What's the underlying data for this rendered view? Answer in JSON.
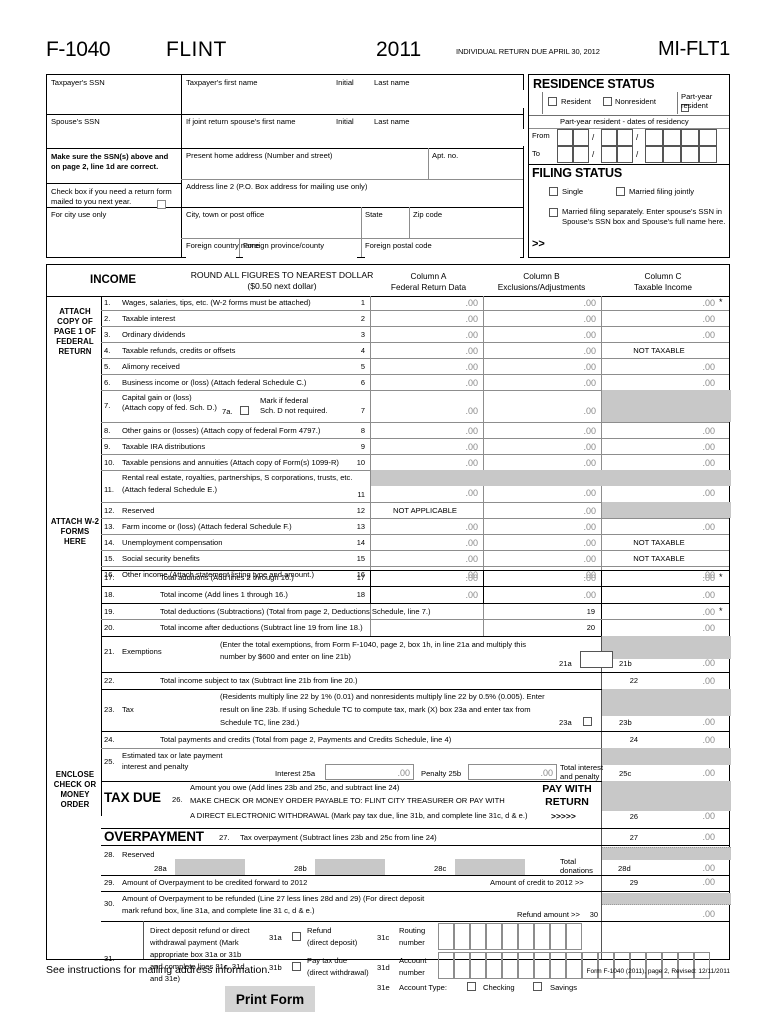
{
  "masthead": {
    "form_number": "F-1040",
    "city": "FLINT",
    "year": "2011",
    "due_notice": "INDIVIDUAL RETURN DUE APRIL 30, 2012",
    "form_code": "MI-FLT1"
  },
  "identity": {
    "taxpayer_ssn_label": "Taxpayer's SSN",
    "spouse_ssn_label": "Spouse's SSN",
    "ssn_warning": "Make sure the SSN(s) above and on page 2, line 1d are correct.",
    "mail_checkbox_note": "Check box if you need a return form mailed to you next year.",
    "city_use_label": "For city use only",
    "taxpayer_first_name_label": "Taxpayer's first name",
    "initial_label": "Initial",
    "last_name_label": "Last name",
    "spouse_first_name_label": "If joint return spouse's first name",
    "spouse_initial_label": "Initial",
    "spouse_last_name_label": "Last name",
    "home_address_label": "Present home address (Number and street)",
    "apt_label": "Apt. no.",
    "address2_label": "Address line 2 (P.O. Box address for mailing use only)",
    "city_label": "City, town or post office",
    "state_label": "State",
    "zip_label": "Zip code",
    "foreign_country_label": "Foreign country name",
    "foreign_province_label": "Foreign province/county",
    "foreign_postal_label": "Foreign postal code"
  },
  "residence": {
    "heading": "RESIDENCE STATUS",
    "options": [
      "Resident",
      "Nonresident",
      "Part-year resident"
    ],
    "dates_caption": "Part-year resident - dates of residency",
    "from_label": "From",
    "to_label": "To",
    "slash": "/"
  },
  "filing": {
    "heading": "FILING STATUS",
    "single": "Single",
    "joint": "Married filing jointly",
    "separate": "Married filing separately. Enter spouse's SSN in Spouse's SSN box and Spouse's full name here.",
    "arrow": ">>"
  },
  "income_header": {
    "title": "INCOME",
    "round_line1": "ROUND ALL FIGURES TO NEAREST DOLLAR",
    "round_line2": "($0.50 next dollar)",
    "col_a_1": "Column A",
    "col_a_2": "Federal Return Data",
    "col_b_1": "Column B",
    "col_b_2": "Exclusions/Adjustments",
    "col_c_1": "Column C",
    "col_c_2": "Taxable Income"
  },
  "side_notes": {
    "attach_federal": "ATTACH COPY OF PAGE 1 OF FEDERAL RETURN",
    "attach_w2": "ATTACH W-2 FORMS HERE",
    "enclose_check": "ENCLOSE CHECK OR MONEY ORDER"
  },
  "zero": ".00",
  "not_taxable": "NOT TAXABLE",
  "not_applicable": "NOT APPLICABLE",
  "star": "*",
  "rows": [
    {
      "no": "1.",
      "text": "Wages, salaries, tips, etc. (W-2 forms must be attached)",
      "ln": "1",
      "a": ".00",
      "b": ".00",
      "c": ".00",
      "star": true
    },
    {
      "no": "2.",
      "text": "Taxable interest",
      "ln": "2",
      "a": ".00",
      "b": ".00",
      "c": ".00"
    },
    {
      "no": "3.",
      "text": "Ordinary dividends",
      "ln": "3",
      "a": ".00",
      "b": ".00",
      "c": ".00"
    },
    {
      "no": "4.",
      "text": "Taxable refunds, credits or offsets",
      "ln": "4",
      "a": ".00",
      "b": ".00",
      "c": "NOT TAXABLE"
    },
    {
      "no": "5.",
      "text": "Alimony received",
      "ln": "5",
      "a": ".00",
      "b": ".00",
      "c": ".00"
    },
    {
      "no": "6.",
      "text": "Business income or (loss) (Attach federal Schedule C.)",
      "ln": "6",
      "a": ".00",
      "b": ".00",
      "c": ".00"
    },
    {
      "no": "7.",
      "text": "Capital gain or (loss) (Attach copy of fed. Sch. D.)",
      "sub": "7a.",
      "note": "Mark if federal Sch. D not required.",
      "ln": "7",
      "a": ".00",
      "b": ".00",
      "c": "SHADED"
    },
    {
      "no": "8.",
      "text": "Other gains or (losses)  (Attach copy of federal Form 4797.)",
      "ln": "8",
      "a": ".00",
      "b": ".00",
      "c": ".00"
    },
    {
      "no": "9.",
      "text": "Taxable IRA distributions",
      "ln": "9",
      "a": ".00",
      "b": ".00",
      "c": ".00"
    },
    {
      "no": "10.",
      "text": "Taxable pensions and annuities  (Attach copy of Form(s) 1099-R)",
      "ln": "10",
      "a": ".00",
      "b": ".00",
      "c": ".00"
    },
    {
      "no": "11.",
      "text": "Rental real estate, royalties, partnerships, S corporations, trusts, etc. (Attach federal Schedule E.)",
      "ln": "11",
      "a": ".00",
      "b": ".00",
      "c": ".00"
    },
    {
      "no": "12.",
      "text": "Reserved",
      "ln": "12",
      "a": "NOT APPLICABLE",
      "b": ".00",
      "c": "SHADED"
    },
    {
      "no": "13.",
      "text": "Farm income or (loss)  (Attach federal Schedule F.)",
      "ln": "13",
      "a": ".00",
      "b": ".00",
      "c": ".00"
    },
    {
      "no": "14.",
      "text": "Unemployment compensation",
      "ln": "14",
      "a": ".00",
      "b": ".00",
      "c": "NOT TAXABLE"
    },
    {
      "no": "15.",
      "text": "Social security benefits",
      "ln": "15",
      "a": ".00",
      "b": ".00",
      "c": "NOT TAXABLE"
    },
    {
      "no": "16.",
      "text": "Other income  (Attach statement listing type and amount.)",
      "ln": "16",
      "a": ".00",
      "b": ".00",
      "c": ".00"
    },
    {
      "no": "17.",
      "text": "Total additions (Add lines 2 through 16.)",
      "indent": true,
      "ln": "17",
      "a": ".00",
      "b": ".00",
      "c": ".00",
      "star": true
    },
    {
      "no": "18.",
      "text": "Total income (Add lines 1 through 16.)",
      "indent": true,
      "ln": "18",
      "a": ".00",
      "b": ".00",
      "c": ".00"
    },
    {
      "no": "19.",
      "text": "Total deductions (Subtractions) (Total from page 2, Deductions Schedule, line 7.)",
      "indent": true,
      "ln": "19",
      "c": ".00",
      "star": true,
      "wide": true
    },
    {
      "no": "20.",
      "text": "Total income after deductions (Subtract line 19 from line 18.)",
      "indent": true,
      "ln": "20",
      "c": ".00",
      "wide": true
    }
  ],
  "line21": {
    "no": "21.",
    "label": "Exemptions",
    "instr_1": "(Enter the total exemptions, from Form F-1040, page 2, box 1h, in line 21a and multiply this",
    "instr_2": "number by $600 and enter on line 21b)",
    "a_tag": "21a",
    "b_tag": "21b",
    "amount": ".00"
  },
  "line22": {
    "no": "22.",
    "text": "Total income subject to tax (Subtract line 21b from line 20.)",
    "ln": "22",
    "amount": ".00"
  },
  "line23": {
    "no": "23.",
    "label": "Tax",
    "instr_1": "(Residents multiply line 22 by 1% (0.01) and nonresidents multiply line 22 by 0.5% (0.005). Enter",
    "instr_2": "result on line 23b. If using Schedule TC to compute tax, mark (X) box 23a and enter tax from",
    "instr_3": "Schedule TC, line 23d.)",
    "a_tag": "23a",
    "b_tag": "23b",
    "amount": ".00"
  },
  "line24": {
    "no": "24.",
    "text": "Total payments and credits  (Total from page 2, Payments and Credits Schedule, line 4)",
    "ln": "24",
    "amount": ".00"
  },
  "line25": {
    "no": "25.",
    "text_1": "Estimated tax or late payment",
    "text_2": "interest and penalty",
    "interest_label": "Interest 25a",
    "interest_amount": ".00",
    "penalty_label": "Penalty 25b",
    "penalty_amount": ".00",
    "total_label_1": "Total interest",
    "total_label_2": "and penalty",
    "c_tag": "25c",
    "amount": ".00"
  },
  "taxdue": {
    "heading": "TAX DUE",
    "no": "26.",
    "line_1": "Amount you owe (Add lines 23b and 25c, and subtract line 24)",
    "line_2": "MAKE CHECK OR MONEY ORDER PAYABLE TO: FLINT CITY TREASURER OR PAY WITH",
    "line_3": "A DIRECT ELECTRONIC WITHDRAWAL (Mark pay tax due, line 31b, and complete line 31c, d & e.)",
    "pay_with_1": "PAY WITH",
    "pay_with_2": "RETURN",
    "arrows": ">>>>>",
    "ln": "26",
    "amount": ".00"
  },
  "overpayment": {
    "heading": "OVERPAYMENT",
    "no": "27.",
    "text": "Tax overpayment (Subtract lines 23b and 25c from line 24)",
    "ln": "27",
    "amount": ".00"
  },
  "line28": {
    "no": "28.",
    "label": "Reserved",
    "a_tag": "28a",
    "b_tag": "28b",
    "c_tag": "28c",
    "total_label_1": "Total",
    "total_label_2": "donations",
    "d_tag": "28d",
    "amount": ".00"
  },
  "line29": {
    "no": "29.",
    "text": "Amount of Overpayment to be credited forward to 2012",
    "credit_label": "Amount of credit to 2012 >>",
    "ln": "29",
    "amount": ".00"
  },
  "line30": {
    "no": "30.",
    "text_1": "Amount of Overpayment to be refunded  (Line 27 less lines 28d and 29) (For direct deposit",
    "text_2": "mark refund box, line 31a, and complete line 31 c, d & e.)",
    "refund_label": "Refund amount >>",
    "ln": "30",
    "amount": ".00"
  },
  "line31": {
    "no": "31.",
    "text_1": "Direct deposit refund or direct",
    "text_2": "withdrawal payment (Mark",
    "text_3": "appropriate box 31a or 31b",
    "text_4": "and complete lines 31c, 31d",
    "text_5": "and 31e)",
    "a_tag": "31a",
    "refund_1": "Refund",
    "refund_2": "(direct deposit)",
    "b_tag": "31b",
    "paytax_1": "Pay tax due",
    "paytax_2": "(direct withdrawal)",
    "c_tag": "31c",
    "routing_1": "Routing",
    "routing_2": "number",
    "d_tag": "31d",
    "account_1": "Account",
    "account_2": "number",
    "e_tag": "31e",
    "account_type_label": "Account Type:",
    "checking": "Checking",
    "savings": "Savings",
    "routing_cells": 9,
    "account_cells": 17
  },
  "footer": {
    "instructions": "See instructions for mailing address information.",
    "revision": "Form F-1040 (2011), page 2, Revised: 12/11/2011",
    "print_button": "Print Form"
  }
}
